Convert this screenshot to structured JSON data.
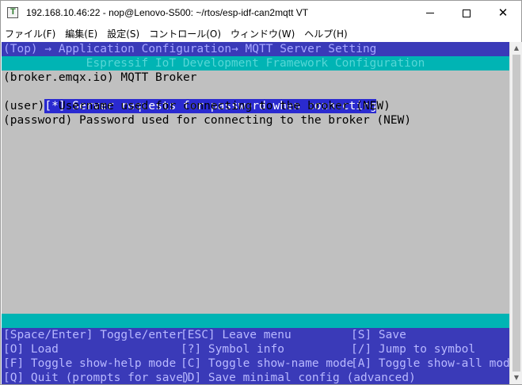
{
  "window": {
    "title": "192.168.10.46:22 - nop@Lenovo-S500: ~/rtos/esp-idf-can2mqtt VT",
    "app_icon": "teraterm-icon",
    "buttons": {
      "minimize": "minimize-icon",
      "maximize": "maximize-icon",
      "close": "close-icon"
    }
  },
  "menubar": {
    "items": [
      {
        "label": "ファイル(F)"
      },
      {
        "label": "編集(E)"
      },
      {
        "label": "設定(S)"
      },
      {
        "label": "コントロール(O)"
      },
      {
        "label": "ウィンドウ(W)"
      },
      {
        "label": "ヘルプ(H)"
      }
    ]
  },
  "terminal": {
    "breadcrumb": "(Top) → Application Configuration→ MQTT Server Setting",
    "header": "Espressif IoT Development Framework Configuration",
    "items": [
      {
        "text": "(broker.emqx.io) MQTT Broker",
        "selected": false
      },
      {
        "text": "[*] Server requests for password when connecting",
        "selected": true
      },
      {
        "text": "(user)  Username used for connecting to the broker (NEW)",
        "selected": false
      },
      {
        "text": "(password) Password used for connecting to the broker (NEW)",
        "selected": false
      }
    ],
    "help": [
      [
        "[Space/Enter] Toggle/enter",
        "[ESC] Leave menu",
        "[S] Save"
      ],
      [
        "[O] Load",
        "[?] Symbol info",
        "[/] Jump to symbol"
      ],
      [
        "[F] Toggle show-help mode",
        "[C] Toggle show-name mode",
        "[A] Toggle show-all mode"
      ],
      [
        "[Q] Quit (prompts for save)",
        "[D] Save minimal config (advanced)",
        ""
      ]
    ]
  },
  "colors": {
    "terminal_bg": "#c0c0c0",
    "bar_blue": "#3a3ab8",
    "bar_cyan": "#00b4b4",
    "selection": "#2a2ad0"
  }
}
